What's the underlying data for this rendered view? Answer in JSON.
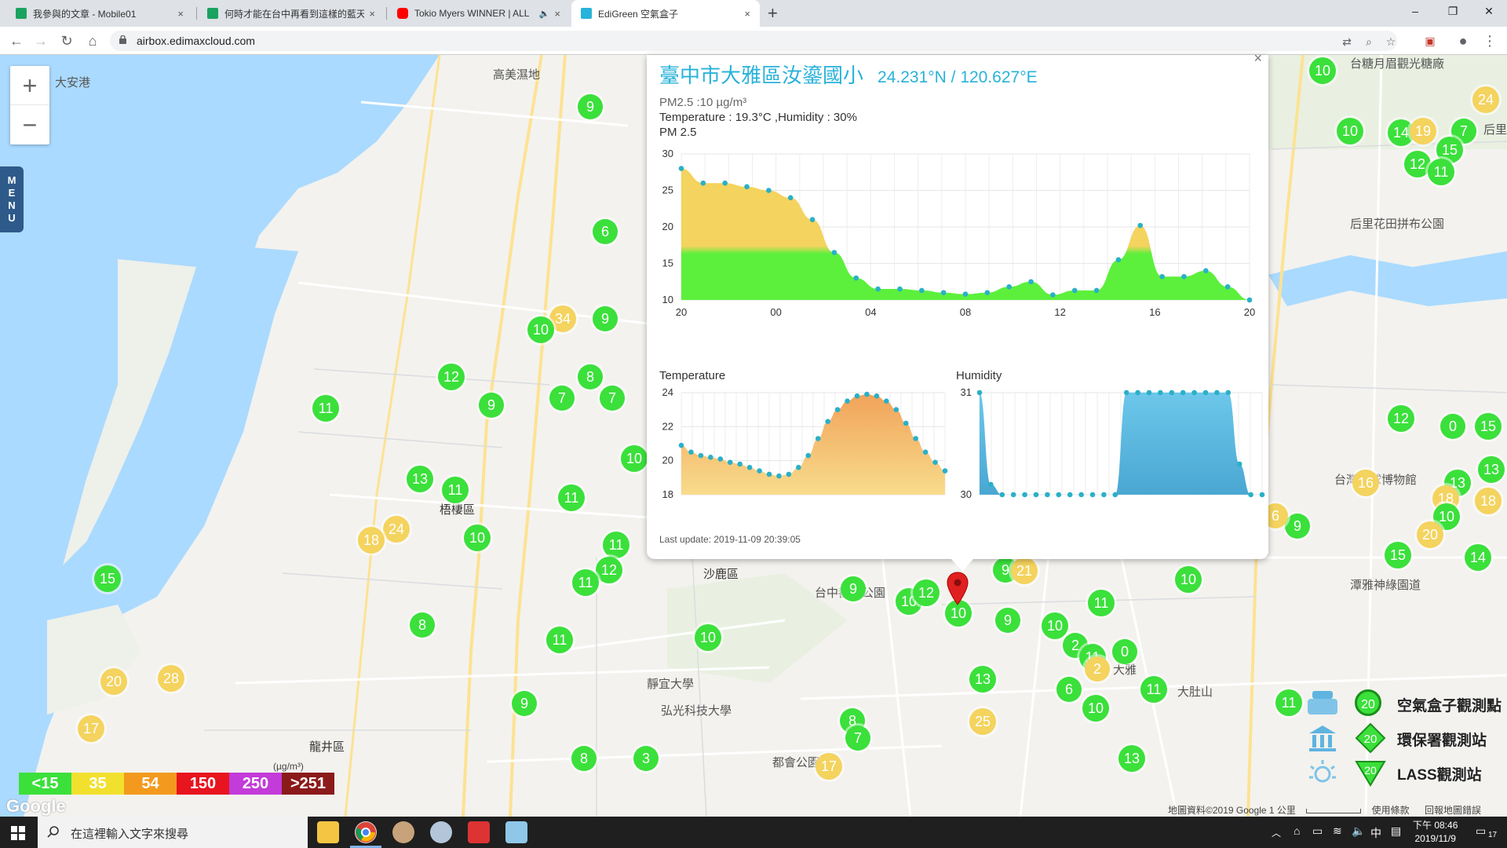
{
  "browser": {
    "tabs": [
      {
        "title": "我參與的文章 - Mobile01",
        "favicon_color": "#1aa260"
      },
      {
        "title": "何時才能在台中再看到這樣的藍天",
        "favicon_color": "#1aa260"
      },
      {
        "title": "Tokio Myers WINNER | ALL",
        "favicon_color": "#ff0000"
      },
      {
        "title": "EdiGreen 空氣盒子",
        "favicon_color": "#29b2d9"
      }
    ],
    "close_glyph": "×",
    "new_tab_glyph": "+",
    "url": "airbox.edimaxcloud.com",
    "window_controls": [
      "–",
      "❐",
      "✕"
    ]
  },
  "map": {
    "zoom_in": "+",
    "zoom_out": "−",
    "menu_label": [
      "M",
      "E",
      "N",
      "U"
    ],
    "places": [
      {
        "label": "高美濕地"
      },
      {
        "label": "梧棲區"
      },
      {
        "label": "沙鹿區"
      },
      {
        "label": "龍井區"
      },
      {
        "label": "大肚山"
      },
      {
        "label": "都會公園"
      },
      {
        "label": "台中都會公園"
      },
      {
        "label": "靜宜大學"
      },
      {
        "label": "弘光科技大學"
      },
      {
        "label": "后里花田拼布公園"
      },
      {
        "label": "潭雅神綠園道"
      },
      {
        "label": "大雅"
      },
      {
        "label": "台糖月眉觀光糖廠"
      },
      {
        "label": "后里"
      },
      {
        "label": "台灣氣球博物館"
      },
      {
        "label": "大安港"
      }
    ],
    "markers": [
      {
        "v": "9",
        "c": "g"
      },
      {
        "v": "6",
        "c": "g"
      },
      {
        "v": "34",
        "c": "y"
      },
      {
        "v": "9",
        "c": "g"
      },
      {
        "v": "10",
        "c": "g"
      },
      {
        "v": "8",
        "c": "g"
      },
      {
        "v": "12",
        "c": "g"
      },
      {
        "v": "7",
        "c": "g"
      },
      {
        "v": "7",
        "c": "g"
      },
      {
        "v": "9",
        "c": "g"
      },
      {
        "v": "11",
        "c": "g"
      },
      {
        "v": "10",
        "c": "g"
      },
      {
        "v": "13",
        "c": "g"
      },
      {
        "v": "11",
        "c": "g"
      },
      {
        "v": "11",
        "c": "g"
      },
      {
        "v": "24",
        "c": "y"
      },
      {
        "v": "18",
        "c": "y"
      },
      {
        "v": "10",
        "c": "g"
      },
      {
        "v": "11",
        "c": "g"
      },
      {
        "v": "12",
        "c": "g"
      },
      {
        "v": "11",
        "c": "g"
      },
      {
        "v": "15",
        "c": "g"
      },
      {
        "v": "8",
        "c": "g"
      },
      {
        "v": "11",
        "c": "g"
      },
      {
        "v": "10",
        "c": "g"
      },
      {
        "v": "9",
        "c": "g"
      },
      {
        "v": "20",
        "c": "y"
      },
      {
        "v": "28",
        "c": "y"
      },
      {
        "v": "17",
        "c": "y"
      },
      {
        "v": "9",
        "c": "g"
      },
      {
        "v": "10",
        "c": "g"
      },
      {
        "v": "9",
        "c": "g"
      },
      {
        "v": "11",
        "c": "g"
      },
      {
        "v": "14",
        "c": "g"
      },
      {
        "v": "10",
        "c": "g"
      },
      {
        "v": "8",
        "c": "g"
      },
      {
        "v": "3",
        "c": "g"
      },
      {
        "v": "8",
        "c": "g"
      },
      {
        "v": "7",
        "c": "g"
      },
      {
        "v": "17",
        "c": "y"
      },
      {
        "v": "12",
        "c": "g"
      },
      {
        "v": "10",
        "c": "g"
      },
      {
        "v": "9",
        "c": "g"
      },
      {
        "v": "21",
        "c": "y"
      },
      {
        "v": "10",
        "c": "g"
      },
      {
        "v": "10",
        "c": "g"
      },
      {
        "v": "2",
        "c": "g"
      },
      {
        "v": "11",
        "c": "g"
      },
      {
        "v": "0",
        "c": "g"
      },
      {
        "v": "2",
        "c": "y"
      },
      {
        "v": "6",
        "c": "g"
      },
      {
        "v": "10",
        "c": "g"
      },
      {
        "v": "11",
        "c": "g"
      },
      {
        "v": "13",
        "c": "g"
      },
      {
        "v": "25",
        "c": "y"
      },
      {
        "v": "13",
        "c": "g"
      },
      {
        "v": "11",
        "c": "g"
      },
      {
        "v": "10",
        "c": "g"
      },
      {
        "v": "10",
        "c": "g"
      },
      {
        "v": "14",
        "c": "g"
      },
      {
        "v": "19",
        "c": "y"
      },
      {
        "v": "7",
        "c": "g"
      },
      {
        "v": "15",
        "c": "g"
      },
      {
        "v": "12",
        "c": "g"
      },
      {
        "v": "11",
        "c": "g"
      },
      {
        "v": "24",
        "c": "y"
      },
      {
        "v": "12",
        "c": "g"
      },
      {
        "v": "0",
        "c": "g"
      },
      {
        "v": "15",
        "c": "g"
      },
      {
        "v": "13",
        "c": "g"
      },
      {
        "v": "16",
        "c": "y"
      },
      {
        "v": "13",
        "c": "g"
      },
      {
        "v": "18",
        "c": "y"
      },
      {
        "v": "10",
        "c": "g"
      },
      {
        "v": "18",
        "c": "y"
      },
      {
        "v": "20",
        "c": "y"
      },
      {
        "v": "9",
        "c": "g"
      },
      {
        "v": "6",
        "c": "y"
      },
      {
        "v": "15",
        "c": "g"
      },
      {
        "v": "14",
        "c": "g"
      },
      {
        "v": "11",
        "c": "g"
      }
    ],
    "legend": [
      {
        "label": "<15",
        "color": "#3be03b"
      },
      {
        "label": "35",
        "color": "#f2e02f"
      },
      {
        "label": "54",
        "color": "#f39a1e"
      },
      {
        "label": "150",
        "color": "#e8141e"
      },
      {
        "label": "250",
        "color": "#c33bd9"
      },
      {
        "label": ">251",
        "color": "#8b1a1a"
      }
    ],
    "legend_unit": "(µg/m³)",
    "google": "Google",
    "station_types": [
      "空氣盒子觀測點",
      "環保署觀測站",
      "LASS觀測站"
    ],
    "station_type_sample": "20",
    "attribution": "地圖資料©2019 Google   1 公里",
    "terms": "使用條款",
    "report": "回報地圖錯誤"
  },
  "popup": {
    "close": "×",
    "title": "臺中市大雅區汝鎏國小",
    "coords": "24.231°N / 120.627°E",
    "pm25_line": "PM2.5 :10 µg/m³",
    "temp_line": "Temperature : 19.3°C ,Humidity : 30%",
    "pm_label": "PM 2.5",
    "temp_label": "Temperature",
    "humid_label": "Humidity",
    "last_update": "Last update: 2019-11-09 20:39:05"
  },
  "chart_data": [
    {
      "type": "area",
      "title": "PM 2.5",
      "x_tick_labels": [
        "20",
        "00",
        "04",
        "08",
        "12",
        "16",
        "20"
      ],
      "ylim": [
        10,
        30
      ],
      "y_ticks": [
        10,
        15,
        20,
        25,
        30
      ],
      "threshold": 17,
      "grid": true,
      "series": [
        {
          "values": [
            28,
            26,
            26,
            25.5,
            25,
            24,
            21,
            16.5,
            13,
            11.5,
            11.5,
            11.3,
            11,
            10.8,
            11,
            11.8,
            12.5,
            10.7,
            11.3,
            11.3,
            15.5,
            20.2,
            13.2,
            13.2,
            14,
            11.8,
            10
          ]
        }
      ]
    },
    {
      "type": "area",
      "title": "Temperature",
      "ylim": [
        18,
        24
      ],
      "y_ticks": [
        18,
        20,
        22,
        24
      ],
      "grid": true,
      "series": [
        {
          "values": [
            20.9,
            20.5,
            20.3,
            20.2,
            20.1,
            19.9,
            19.8,
            19.6,
            19.4,
            19.2,
            19.1,
            19.2,
            19.6,
            20.3,
            21.3,
            22.3,
            23.0,
            23.5,
            23.8,
            23.9,
            23.8,
            23.5,
            23.0,
            22.2,
            21.3,
            20.5,
            19.9,
            19.4
          ]
        }
      ]
    },
    {
      "type": "area",
      "title": "Humidity",
      "ylim": [
        30,
        31
      ],
      "y_ticks": [
        30,
        31
      ],
      "grid": true,
      "series": [
        {
          "values": [
            31,
            30.1,
            30,
            30,
            30,
            30,
            30,
            30,
            30,
            30,
            30,
            30,
            30,
            31,
            31,
            31,
            31,
            31,
            31,
            31,
            31,
            31,
            31,
            30.3,
            30,
            30
          ]
        }
      ]
    }
  ],
  "taskbar": {
    "search_placeholder": "在這裡輸入文字來搜尋",
    "time": "下午 08:46",
    "date": "2019/11/9",
    "ime": "中",
    "notify_count": "17"
  }
}
